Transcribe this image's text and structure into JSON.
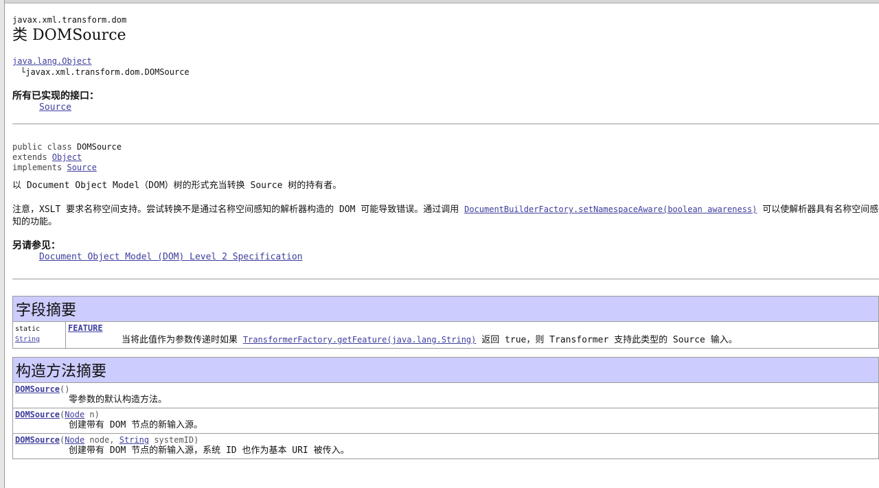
{
  "header": {
    "package": "javax.xml.transform.dom",
    "title": "类 DOMSource"
  },
  "hierarchy": {
    "parent": "java.lang.Object",
    "child": "└javax.xml.transform.dom.DOMSource"
  },
  "interfaces": {
    "label": "所有已实现的接口：",
    "item": "Source"
  },
  "declaration": {
    "line1_prefix": "public class ",
    "line1_name": "DOMSource",
    "line2_prefix": "extends ",
    "line2_link": "Object",
    "line3_prefix": "implements ",
    "line3_link": "Source"
  },
  "description": {
    "p1": "以 Document Object Model（DOM）树的形式充当转换 Source 树的持有者。",
    "p2_pre": "注意，XSLT 要求名称空间支持。尝试转换不是通过名称空间感知的解析器构造的 DOM 可能导致错误。通过调用 ",
    "p2_link": "DocumentBuilderFactory.setNamespaceAware(boolean awareness)",
    "p2_post": " 可以使解析器具有名称空间感知的功能。"
  },
  "see_also": {
    "label": "另请参见：",
    "link": "Document Object Model (DOM) Level 2 Specification"
  },
  "field_summary": {
    "header": "字段摘要",
    "modifier": "static",
    "type": "String",
    "name": "FEATURE",
    "desc_pre": "当将此值作为参数传递时如果 ",
    "desc_link": "TransformerFactory.getFeature(java.lang.String)",
    "desc_post": " 返回 true，则 Transformer 支持此类型的 Source 输入。"
  },
  "constructor_summary": {
    "header": "构造方法摘要",
    "rows": [
      {
        "name": "DOMSource",
        "p1_type": "",
        "p1_rest": "()",
        "p2_type": "",
        "p2_rest": "",
        "desc": "零参数的默认构造方法。"
      },
      {
        "name": "DOMSource",
        "open": "(",
        "p1_type": "Node",
        "p1_rest": " n)",
        "p2_type": "",
        "p2_rest": "",
        "desc": "创建带有 DOM 节点的新输入源。"
      },
      {
        "name": "DOMSource",
        "open": "(",
        "p1_type": "Node",
        "p1_rest": " node, ",
        "p2_type": "String",
        "p2_rest": " systemID)",
        "desc": "创建带有 DOM 节点的新输入源，系统 ID 也作为基本 URI 被传入。"
      }
    ]
  },
  "colors": {
    "table_header_bg": "#ccccff",
    "link": "#3d3d9e"
  }
}
